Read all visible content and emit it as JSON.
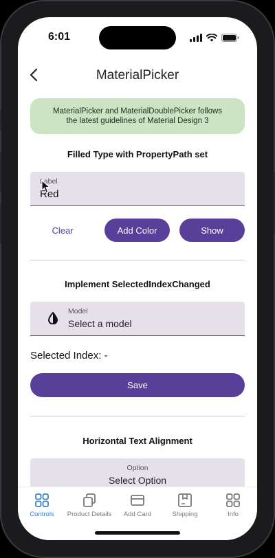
{
  "status": {
    "time": "6:01"
  },
  "nav": {
    "title": "MaterialPicker"
  },
  "banner": {
    "text": "MaterialPicker and MaterialDoublePicker follows the latest guidelines of Material Design 3"
  },
  "section1": {
    "heading": "Filled Type with PropertyPath set",
    "field_label": "Label",
    "field_value": "Red",
    "clear_label": "Clear",
    "add_color_label": "Add Color",
    "show_label": "Show"
  },
  "section2": {
    "heading": "Implement SelectedIndexChanged",
    "field_label": "Model",
    "field_placeholder": "Select a model",
    "selected_index_text": "Selected Index: -",
    "save_label": "Save"
  },
  "section3": {
    "heading": "Horizontal Text Alignment",
    "field_label": "Option",
    "field_placeholder": "Select Option"
  },
  "tabs": [
    {
      "label": "Controls",
      "icon": "grid-icon",
      "active": true
    },
    {
      "label": "Product Details",
      "icon": "copy-icon",
      "active": false
    },
    {
      "label": "Add Card",
      "icon": "card-icon",
      "active": false
    },
    {
      "label": "Shipping",
      "icon": "box-icon",
      "active": false
    },
    {
      "label": "Info",
      "icon": "grid-icon",
      "active": false
    }
  ],
  "colors": {
    "accent": "#5a3f9a",
    "banner_bg": "#cde4c3",
    "field_bg": "#e6e0ea",
    "tab_active": "#3b7fc4"
  }
}
